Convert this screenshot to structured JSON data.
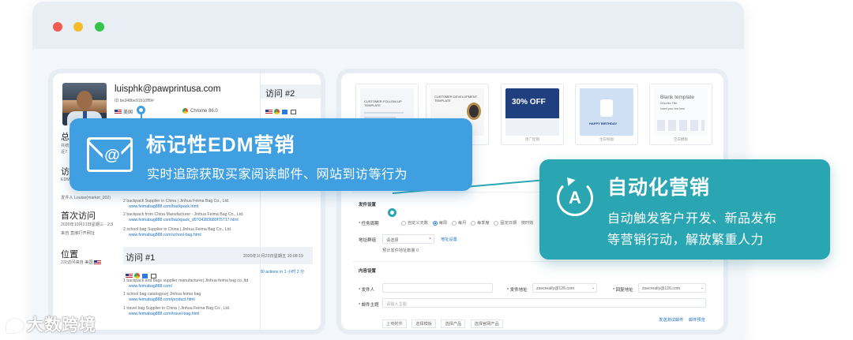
{
  "window": {
    "buttons": [
      "close",
      "minimize",
      "maximize"
    ]
  },
  "profile": {
    "email": "luisphk@pawprintusa.com",
    "id_line": "ID be348be91b10ff9#",
    "country": "美国",
    "browser": "Chrome 86.0",
    "section_total": "总访",
    "total_lines": [
      "共统",
      "近7"
    ],
    "section_visit_source": "访问",
    "source_lines": [
      "EDM",
      "发件人 Louise(market_002)"
    ],
    "section_first_visit": "首次访问",
    "first_visit_time": "2020年10月21日星期三 - 2:3",
    "first_visit_source": "来自 直接打开网址",
    "section_location": "位置",
    "location_detail": "2次访问来自 美国"
  },
  "page_list_top": [
    {
      "title": "backpack Supplier in China | Jinhua Feima Bag Co., Ltd.",
      "url": "www.feimabag888.com/backpack.html"
    },
    {
      "title": "backpack from China Manufacturer - Jinhua Feima Bag Co., Ltd.",
      "url": "www.feimabag888.com/backpack_d9704383680f75717.html"
    },
    {
      "title": "school bag Supplier in China | Jinhua Feima Bag Co., Ltd.",
      "url": "www.feimabag888.com/school-bag.html"
    }
  ],
  "visit1": {
    "title": "访问 #1",
    "time": "2020年10月23日星期五 10:08:19",
    "actions": "30 actions in 1 小时 2 分",
    "pages": [
      {
        "title": "backpack and bags supplier manufacturer| Jinhua feima bag co.,ltd",
        "url": "www.feimabag888.com/"
      },
      {
        "title": "school bag catalogyue| Jinhua feima bag",
        "url": "www.feimabag888.com/product.html"
      },
      {
        "title": "travel bag Supplier in China | Jinhua Feima Bag Co., Ltd.",
        "url": "www.feimabag888.com/travel-bag.html"
      }
    ]
  },
  "visit2": {
    "title": "访问 #2"
  },
  "templates": [
    {
      "caption": "",
      "heading": "CUSTOMER FOLLOW-UP TEMPLATE"
    },
    {
      "caption": "",
      "heading": "CUSTOMER DEVELOPMENT TEMPLATE"
    },
    {
      "caption": "黑广促销",
      "heading": "30% OFF"
    },
    {
      "caption": "生日祝福",
      "heading": "HAPPY BIRTHDAY"
    },
    {
      "caption": "空白模板",
      "heading": "Blank template",
      "sub": "Describe Title",
      "sub2": "Insert your text here"
    }
  ],
  "send_settings": {
    "title": "发件设置",
    "task_type_label": "任务周期",
    "options": [
      "自定义天数",
      "每周",
      "每月",
      "每季度",
      "固定日期",
      "按时效"
    ],
    "selected_option": "每周",
    "address_label": "地址群组",
    "address_value": "请选择",
    "address_link": "地址设置",
    "address_hint": "预计发件地址数量 0"
  },
  "content_settings": {
    "title": "内容设置",
    "sender_label": "发件人",
    "from_label": "发件地址",
    "from_value": "zsecreally@126.com",
    "reply_label": "回复地址",
    "reply_value": "zsecreally@126.com",
    "subject_label": "邮件主题",
    "subject_placeholder": "请输入主题",
    "toolbar": [
      "上传附件",
      "选择模板",
      "选择产品",
      "选择官网产品"
    ],
    "link_test": "发送测试邮件",
    "link_preview": "邮件预览"
  },
  "callout_edm": {
    "title": "标记性EDM营销",
    "subtitle": "实时追踪获取买家阅读邮件、网站到访等行为"
  },
  "callout_auto": {
    "title": "自动化营销",
    "subtitle_line1": "自动触发客户开发、新品发布",
    "subtitle_line2": "等营销行动，解放繁重人力"
  },
  "watermark": "大数跨境",
  "colors": {
    "edm_callout": "#3f9fe0",
    "auto_callout": "#2aa6b3",
    "link": "#1e6fbf",
    "window_close": "#f05a4f",
    "window_min": "#f5bb2b",
    "window_max": "#34c64a"
  }
}
